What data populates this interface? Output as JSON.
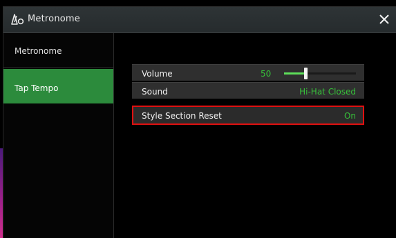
{
  "window": {
    "title": "Metronome",
    "icon": "metronome-icon",
    "close_icon": "close-icon"
  },
  "sidebar": {
    "items": [
      {
        "label": "Metronome",
        "selected": false
      },
      {
        "label": "Tap Tempo",
        "selected": true
      }
    ]
  },
  "settings": {
    "volume": {
      "label": "Volume",
      "value": "50",
      "level": 0.5
    },
    "sound": {
      "label": "Sound",
      "value": "Hi-Hat Closed"
    },
    "style_section_reset": {
      "label": "Style Section Reset",
      "value": "On",
      "highlighted": true
    }
  },
  "colors": {
    "accent_green": "#37c23a",
    "selected_tab": "#2c8b3c",
    "highlight_border": "#e01010"
  }
}
